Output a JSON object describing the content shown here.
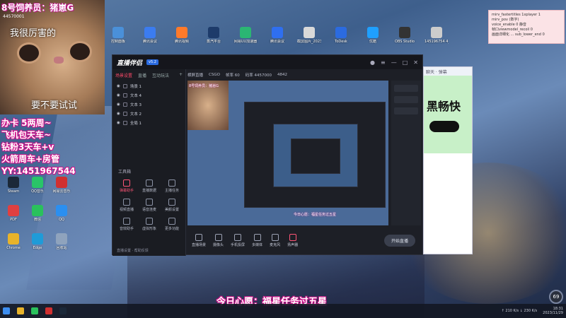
{
  "overlay": {
    "title": "8号饲养员：猪崽G",
    "cam_id": "44570001",
    "subtitle_top": "我很厉害的",
    "subtitle_bottom": "要不要试试",
    "promo_lines": [
      "办卡 5两周~",
      "飞机包天车~",
      "钻粉3天车+v",
      "火箭周车+房管",
      "YY:1451967544"
    ],
    "wish": "今日心愿：福星任务过五星"
  },
  "note_window": {
    "lines": [
      "mirv_fastertitles 1xplayer 1",
      "mirv_pov (数字)",
      "voice_enable 0 静音",
      "帧口viewmodel_recoil 0",
      "画面详细化 ... sub_lower_end 0"
    ]
  },
  "desktop_icons": [
    {
      "label": "控制面板",
      "color": "#4a90d9"
    },
    {
      "label": "腾讯会议",
      "color": "#3b7cf0"
    },
    {
      "label": "腾讯视频",
      "color": "#ff7a2a"
    },
    {
      "label": "蒸汽平台",
      "color": "#1d3b6a"
    },
    {
      "label": "网易UU加速器",
      "color": "#2bb673"
    },
    {
      "label": "腾讯会议",
      "color": "#2f6ff0"
    },
    {
      "label": "截屏图片_2023",
      "color": "#d9d9d9"
    },
    {
      "label": "ToDesk",
      "color": "#2b6be0"
    },
    {
      "label": "优酷",
      "color": "#1fa0ff"
    },
    {
      "label": "OBS Studio",
      "color": "#333333"
    },
    {
      "label": "145196754 4_2023",
      "color": "#cccccc"
    },
    {
      "label": "Steam",
      "color": "#1b2838"
    },
    {
      "label": "QQ音乐",
      "color": "#29c468"
    },
    {
      "label": "网易云音乐",
      "color": "#d03030"
    },
    {
      "label": "PDF",
      "color": "#e04040"
    },
    {
      "label": "微信",
      "color": "#2ac15c"
    },
    {
      "label": "QQ",
      "color": "#2b8ff0"
    },
    {
      "label": "Chrome",
      "color": "#e8b32a"
    },
    {
      "label": "Edge",
      "color": "#1f9bd8"
    },
    {
      "label": "回收站",
      "color": "#8fa3bd"
    }
  ],
  "app": {
    "name": "直播伴侣",
    "version": "v5.2",
    "left_tabs": [
      "场景设置",
      "直播",
      "互动玩法"
    ],
    "scenes": [
      "场景 1",
      "文本 4",
      "文本 3",
      "文本 2",
      "全局 1"
    ],
    "tools_title": "工具箱",
    "tools": [
      {
        "label": "弹幕助手",
        "hot": true
      },
      {
        "label": "直播数据",
        "hot": false
      },
      {
        "label": "主播任务",
        "hot": false
      },
      {
        "label": "视频直播",
        "hot": false
      },
      {
        "label": "语音连麦",
        "hot": false
      },
      {
        "label": "美颜设置",
        "hot": false
      },
      {
        "label": "音效助手",
        "hot": false
      },
      {
        "label": "虚拟形象",
        "hot": false
      },
      {
        "label": "更多功能",
        "hot": false
      }
    ],
    "left_footer": "直播设置 · 帮助反馈",
    "preview_head": [
      "横屏直播",
      "CSGO",
      "帧率 60",
      "码率 4457000",
      "4842"
    ],
    "preview_tag": "8号饲养员：猪崽G",
    "preview_tag2": "今日心愿：福星任务过五星",
    "bottom": [
      "直播场景",
      "摄像头",
      "手机投屏",
      "多媒体",
      "麦克风",
      "扬声器"
    ],
    "start_label": "开始直播"
  },
  "side_window": {
    "title": "聊天 · 弹幕",
    "banner_text": "黑畅快"
  },
  "tray": {
    "net": "↑ 210 K/s ↓ 230 K/s",
    "time": "18:31",
    "date": "2023/11/29",
    "volume": "69"
  }
}
